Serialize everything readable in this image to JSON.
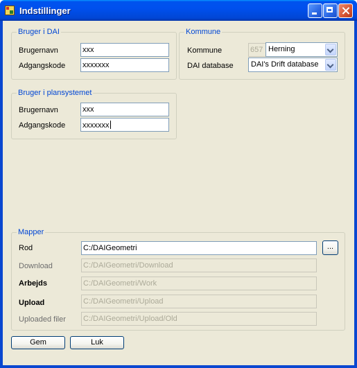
{
  "window": {
    "title": "Indstillinger"
  },
  "dai_user": {
    "legend": "Bruger i DAI",
    "username_label": "Brugernavn",
    "username_value": "xxx",
    "password_label": "Adgangskode",
    "password_value": "xxxxxxx"
  },
  "kommune": {
    "legend": "Kommune",
    "kommune_label": "Kommune",
    "kommune_code": "657",
    "kommune_selected": "Herning",
    "database_label": "DAI database",
    "database_selected": "DAI's Drift database"
  },
  "plan_user": {
    "legend": "Bruger i plansystemet",
    "username_label": "Brugernavn",
    "username_value": "xxx",
    "password_label": "Adgangskode",
    "password_value": "xxxxxxx"
  },
  "mapper": {
    "legend": "Mapper",
    "rod_label": "Rod",
    "rod_value": "C:/DAIGeometri",
    "browse_label": "...",
    "download_label": "Download",
    "download_value": "C:/DAIGeometri/Download",
    "arbejds_label": "Arbejds",
    "arbejds_value": "C:/DAIGeometri/Work",
    "upload_label": "Upload",
    "upload_value": "C:/DAIGeometri/Upload",
    "uploaded_label": "Uploaded filer",
    "uploaded_value": "C:/DAIGeometri/Upload/Old"
  },
  "buttons": {
    "save": "Gem",
    "close": "Luk"
  }
}
